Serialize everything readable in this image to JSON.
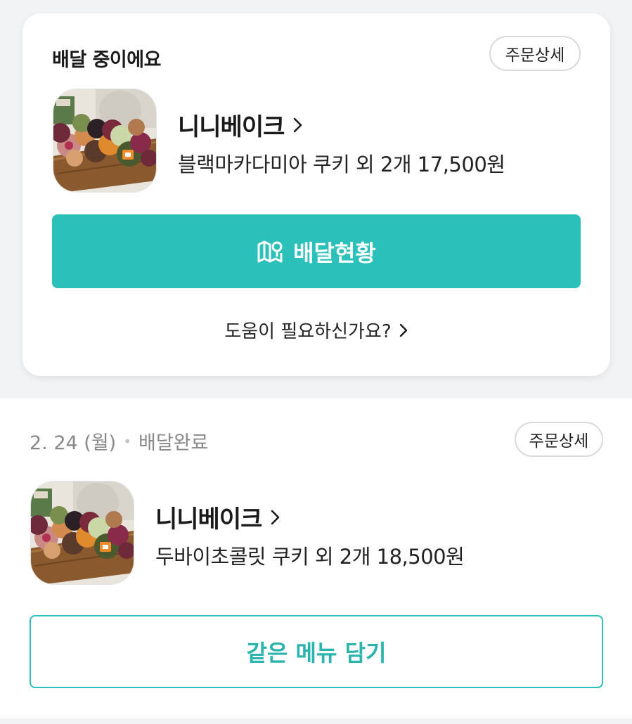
{
  "active_order": {
    "status_title": "배달 중이에요",
    "detail_button": "주문상세",
    "store_name": "니니베이크",
    "order_summary": "블랙마카다미아 쿠키 외 2개 17,500원",
    "track_button": "배달현황",
    "help_link": "도움이 필요하신가요?"
  },
  "past_order": {
    "date": "2. 24 (월)",
    "separator": "•",
    "status": "배달완료",
    "detail_button": "주문상세",
    "store_name": "니니베이크",
    "order_summary": "두바이초콜릿 쿠키 외 2개 18,500원",
    "reorder_button": "같은 메뉴 담기"
  },
  "colors": {
    "accent": "#2bc0b9",
    "background": "#f2f3f5",
    "card": "#ffffff"
  },
  "icons": [
    "map-pin-icon",
    "chevron-right-icon"
  ]
}
